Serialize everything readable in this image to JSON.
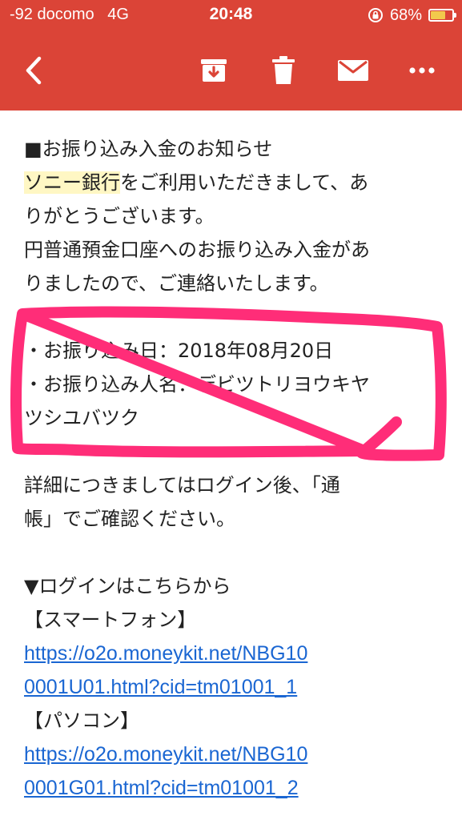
{
  "status_bar": {
    "carrier": "-92 docomo",
    "network": "4G",
    "time": "20:48",
    "battery": "68%",
    "battery_level": 0.68
  },
  "toolbar": {
    "back_icon": "chevron-left-icon",
    "archive_icon": "archive-icon",
    "delete_icon": "trash-icon",
    "mark_unread_icon": "mail-icon",
    "more_icon": "more-horizontal-icon",
    "color": "#db4437"
  },
  "email": {
    "line1": "■お振り込み入金のお知らせ",
    "bank_name": "ソニー銀行",
    "line2_rest": "をご利用いただきまして、あ",
    "line3": "りがとうございます。",
    "line4": "円普通預金口座へのお振り込み入金があ",
    "line5": "りましたので、ご連絡いたします。",
    "date_line": "・お振り込み日：2018年08月20日",
    "name_line1": "・お振り込み人名：デビツトリヨウキヤ",
    "name_line2": "ツシユバツク",
    "detail_line1": "詳細につきましてはログイン後、「通",
    "detail_line2": "帳」でご確認ください。",
    "login_header": "▼ログインはこちらから",
    "smartphone_label": "【スマートフォン】",
    "smartphone_link_1": "https://o2o.moneykit.net/NBG10",
    "smartphone_link_2": "0001U01.html?cid=tm01001_1",
    "pc_label": "【パソコン】",
    "pc_link_1": "https://o2o.moneykit.net/NBG10",
    "pc_link_2": "0001G01.html?cid=tm01001_2"
  },
  "annotation": {
    "color": "#ff2d78"
  }
}
